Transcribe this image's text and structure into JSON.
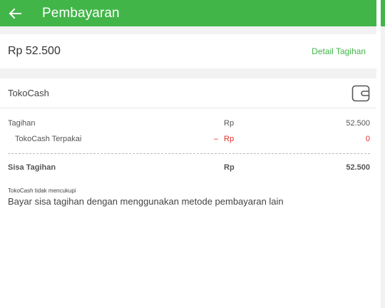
{
  "header": {
    "title": "Pembayaran",
    "back_icon": "arrow-left-icon"
  },
  "summary": {
    "amount": "Rp 52.500",
    "detail_link": "Detail Tagihan"
  },
  "method": {
    "name": "TokoCash",
    "icon": "wallet-icon"
  },
  "breakdown": {
    "tagihan": {
      "label": "Tagihan",
      "currency": "Rp",
      "value": "52.500"
    },
    "tokocash_used": {
      "label": "TokoCash Terpakai",
      "sign": "–",
      "currency": "Rp",
      "value": "0"
    },
    "remaining": {
      "label": "Sisa Tagihan",
      "currency": "Rp",
      "value": "52.500"
    }
  },
  "notice": {
    "title": "TokoCash tidak mencukupi",
    "text": "Bayar sisa tagihan dengan menggunakan metode pembayaran lain"
  },
  "colors": {
    "brand": "#42b549",
    "negative": "#e32b2b"
  }
}
